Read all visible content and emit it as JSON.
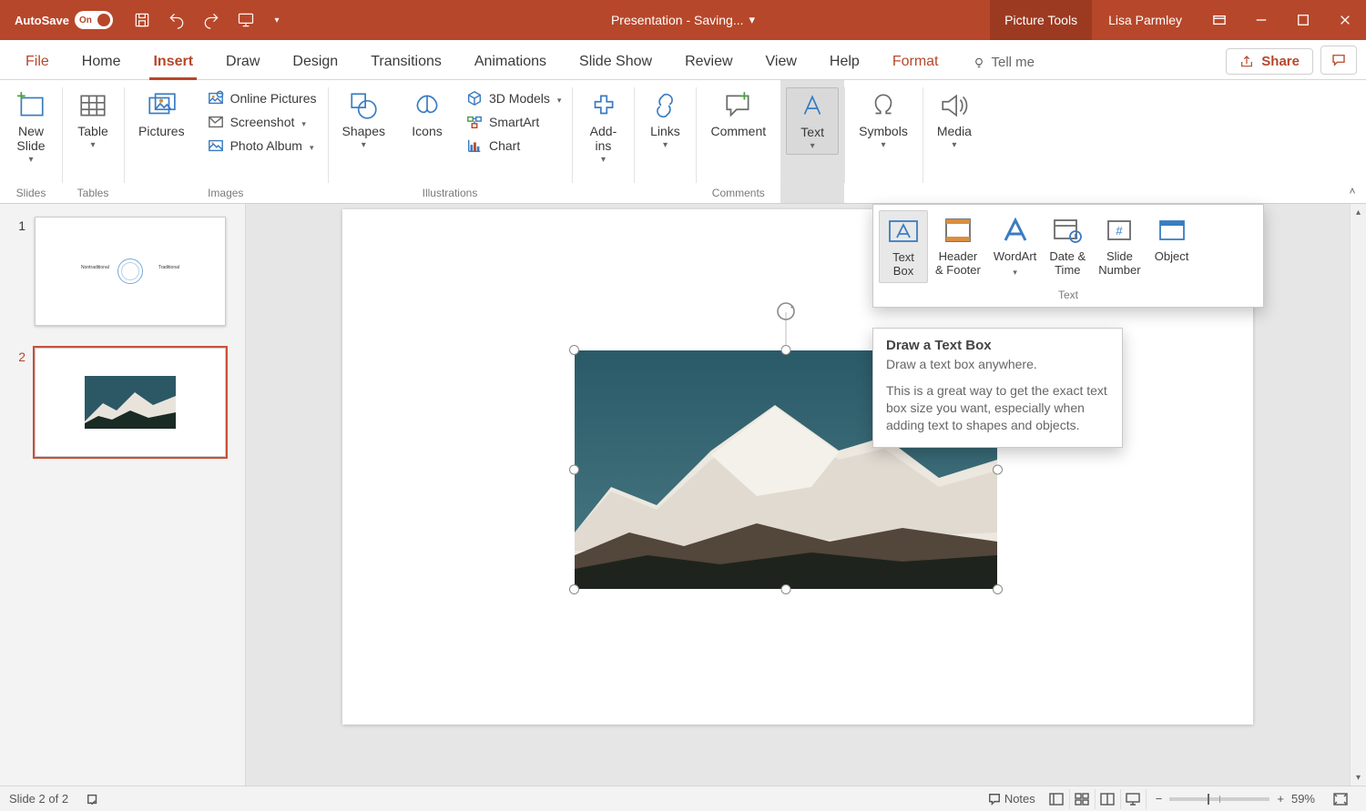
{
  "titlebar": {
    "autosave_label": "AutoSave",
    "autosave_on": "On",
    "doc_title": "Presentation - Saving...",
    "context_tab": "Picture Tools",
    "user": "Lisa Parmley"
  },
  "tabs": {
    "file": "File",
    "home": "Home",
    "insert": "Insert",
    "draw": "Draw",
    "design": "Design",
    "transitions": "Transitions",
    "animations": "Animations",
    "slideshow": "Slide Show",
    "review": "Review",
    "view": "View",
    "help": "Help",
    "format": "Format",
    "tell_me": "Tell me",
    "share": "Share"
  },
  "ribbon": {
    "groups": {
      "slides": {
        "label": "Slides",
        "new_slide": "New\nSlide"
      },
      "tables": {
        "label": "Tables",
        "table": "Table"
      },
      "images": {
        "label": "Images",
        "pictures": "Pictures",
        "online_pictures": "Online Pictures",
        "screenshot": "Screenshot",
        "photo_album": "Photo Album"
      },
      "illustrations": {
        "label": "Illustrations",
        "shapes": "Shapes",
        "icons": "Icons",
        "models": "3D Models",
        "smartart": "SmartArt",
        "chart": "Chart"
      },
      "addins": {
        "label": "",
        "addins": "Add-\nins"
      },
      "links": {
        "label": "",
        "links": "Links"
      },
      "comments": {
        "label": "Comments",
        "comment": "Comment"
      },
      "text": {
        "label": "",
        "text": "Text"
      },
      "symbols": {
        "label": "",
        "symbols": "Symbols"
      },
      "media": {
        "label": "",
        "media": "Media"
      }
    }
  },
  "text_gallery": {
    "text_box": "Text\nBox",
    "header_footer": "Header\n& Footer",
    "wordart": "WordArt",
    "date_time": "Date &\nTime",
    "slide_number": "Slide\nNumber",
    "object": "Object",
    "group_label": "Text"
  },
  "tooltip": {
    "title": "Draw a Text Box",
    "line1": "Draw a text box anywhere.",
    "line2": "This is a great way to get the exact text box size you want, especially when adding text to shapes and objects."
  },
  "thumbs": {
    "n1": "1",
    "n2": "2",
    "t1_left": "Nontraditional",
    "t1_right": "Traditional"
  },
  "statusbar": {
    "slide_of": "Slide 2 of 2",
    "notes": "Notes",
    "zoom_pct": "59%"
  }
}
